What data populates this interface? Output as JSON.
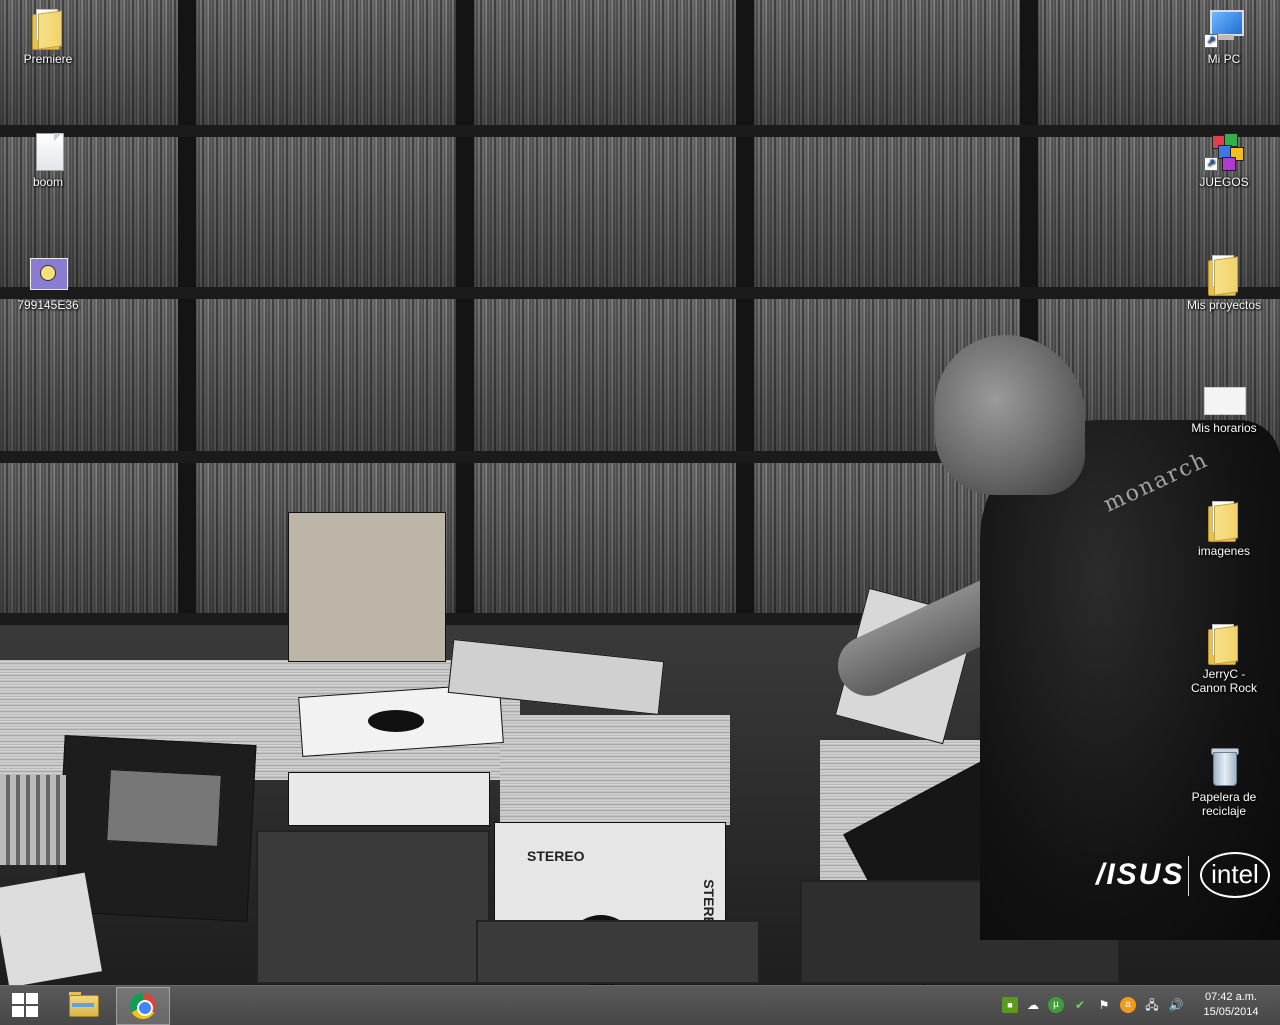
{
  "desktop": {
    "icons_left": [
      {
        "label": "Premiere",
        "icon": "folder-icon"
      },
      {
        "label": "boom",
        "icon": "text-document-icon"
      },
      {
        "label": "799145E36",
        "icon": "image-shortcut-icon"
      }
    ],
    "icons_right": [
      {
        "label": "Mi PC",
        "icon": "computer-icon"
      },
      {
        "label": "JUEGOS",
        "icon": "games-shortcut-icon"
      },
      {
        "label": "Mis proyectos",
        "icon": "folder-icon"
      },
      {
        "label": "Mis horarios",
        "icon": "document-icon"
      },
      {
        "label": "imagenes",
        "icon": "folder-icon"
      },
      {
        "label": "JerryC - Canon Rock",
        "icon": "folder-icon"
      },
      {
        "label": "Papelera de reciclaje",
        "icon": "recycle-bin-icon"
      }
    ]
  },
  "wallpaper": {
    "brand_left": "/ISUS",
    "brand_right": "intel",
    "album_labels": [
      "STEREO",
      "STEREO"
    ],
    "shirt_print": "monarch"
  },
  "taskbar": {
    "start": "start-icon",
    "pinned": [
      {
        "name": "File Explorer",
        "icon": "file-explorer-icon"
      },
      {
        "name": "Google Chrome",
        "icon": "chrome-icon",
        "active": true
      }
    ],
    "tray": [
      "nvidia-icon",
      "onedrive-icon",
      "utorrent-icon",
      "security-icon",
      "action-center-flag-icon",
      "avast-icon",
      "network-icon",
      "volume-icon"
    ],
    "clock": {
      "time": "07:42 a.m.",
      "date": "15/05/2014"
    }
  },
  "colors": {
    "taskbar": "#4f4f4f",
    "folder": "#f1d36a",
    "chrome_active": "#ffffff"
  }
}
